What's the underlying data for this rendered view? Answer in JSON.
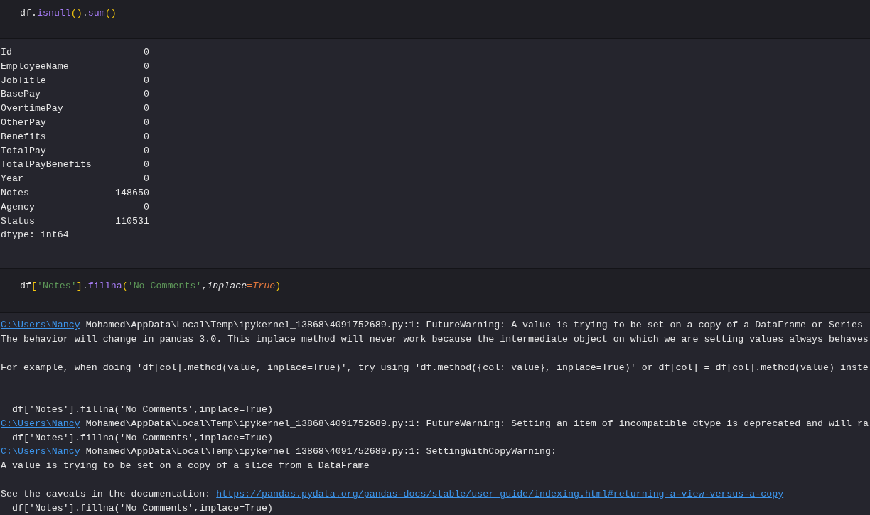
{
  "cells": [
    {
      "code": [
        {
          "kind": "name",
          "text": "df"
        },
        {
          "kind": "punct",
          "text": "."
        },
        {
          "kind": "func",
          "text": "isnull"
        },
        {
          "kind": "paren",
          "text": "()"
        },
        {
          "kind": "punct",
          "text": "."
        },
        {
          "kind": "func",
          "text": "sum"
        },
        {
          "kind": "paren",
          "text": "()"
        }
      ],
      "output": {
        "kind": "series",
        "rows": [
          {
            "name": "Id",
            "value": "0"
          },
          {
            "name": "EmployeeName",
            "value": "0"
          },
          {
            "name": "JobTitle",
            "value": "0"
          },
          {
            "name": "BasePay",
            "value": "0"
          },
          {
            "name": "OvertimePay",
            "value": "0"
          },
          {
            "name": "OtherPay",
            "value": "0"
          },
          {
            "name": "Benefits",
            "value": "0"
          },
          {
            "name": "TotalPay",
            "value": "0"
          },
          {
            "name": "TotalPayBenefits",
            "value": "0"
          },
          {
            "name": "Year",
            "value": "0"
          },
          {
            "name": "Notes",
            "value": "148650"
          },
          {
            "name": "Agency",
            "value": "0"
          },
          {
            "name": "Status",
            "value": "110531"
          }
        ],
        "dtype": "dtype: int64"
      }
    },
    {
      "code": [
        {
          "kind": "name",
          "text": "df"
        },
        {
          "kind": "paren",
          "text": "["
        },
        {
          "kind": "string",
          "text": "'Notes'"
        },
        {
          "kind": "paren",
          "text": "]"
        },
        {
          "kind": "punct",
          "text": "."
        },
        {
          "kind": "func",
          "text": "fillna"
        },
        {
          "kind": "paren",
          "text": "("
        },
        {
          "kind": "string",
          "text": "'No Comments'"
        },
        {
          "kind": "punct",
          "text": ","
        },
        {
          "kind": "kwarg",
          "text": "inplace"
        },
        {
          "kind": "op",
          "text": "="
        },
        {
          "kind": "const",
          "text": "True"
        },
        {
          "kind": "paren",
          "text": ")"
        }
      ],
      "output": {
        "kind": "stream",
        "lines": [
          {
            "kind": "path",
            "link": "C:\\Users\\Nancy",
            "text": " Mohamed\\AppData\\Local\\Temp\\ipykernel_13868\\4091752689.py:1: FutureWarning: A value is trying to be set on a copy of a DataFrame or Series"
          },
          {
            "kind": "text",
            "text": "The behavior will change in pandas 3.0. This inplace method will never work because the intermediate object on which we are setting values always behaves"
          },
          {
            "kind": "blank"
          },
          {
            "kind": "text",
            "text": "For example, when doing 'df[col].method(value, inplace=True)', try using 'df.method({col: value}, inplace=True)' or df[col] = df[col].method(value) inste"
          },
          {
            "kind": "blank"
          },
          {
            "kind": "blank"
          },
          {
            "kind": "code",
            "text": "  df['Notes'].fillna('No Comments',inplace=True)"
          },
          {
            "kind": "path",
            "link": "C:\\Users\\Nancy",
            "text": " Mohamed\\AppData\\Local\\Temp\\ipykernel_13868\\4091752689.py:1: FutureWarning: Setting an item of incompatible dtype is deprecated and will ra"
          },
          {
            "kind": "code",
            "text": "  df['Notes'].fillna('No Comments',inplace=True)"
          },
          {
            "kind": "path",
            "link": "C:\\Users\\Nancy",
            "text": " Mohamed\\AppData\\Local\\Temp\\ipykernel_13868\\4091752689.py:1: SettingWithCopyWarning:"
          },
          {
            "kind": "text",
            "text": "A value is trying to be set on a copy of a slice from a DataFrame"
          },
          {
            "kind": "blank"
          },
          {
            "kind": "doc",
            "text": "See the caveats in the documentation: ",
            "link": "https://pandas.pydata.org/pandas-docs/stable/user_guide/indexing.html#returning-a-view-versus-a-copy"
          },
          {
            "kind": "code",
            "text": "  df['Notes'].fillna('No Comments',inplace=True)"
          }
        ]
      }
    }
  ]
}
